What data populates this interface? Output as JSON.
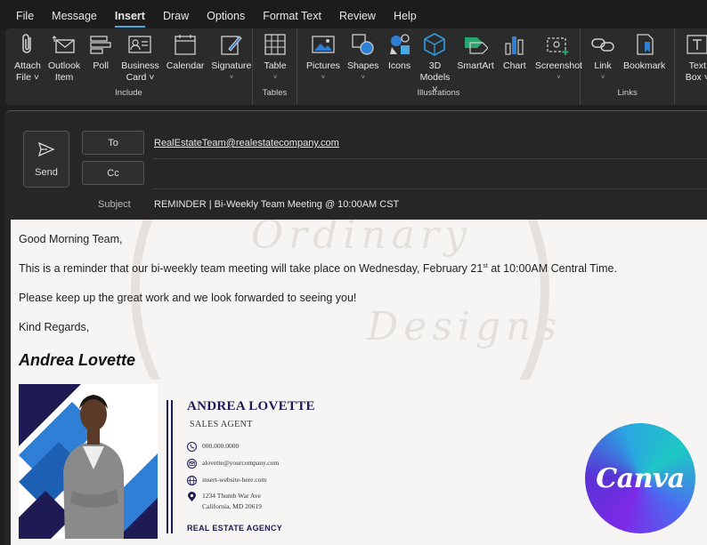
{
  "menu": [
    "File",
    "Message",
    "Insert",
    "Draw",
    "Options",
    "Format Text",
    "Review",
    "Help"
  ],
  "menu_active": "Insert",
  "ribbon": {
    "include": {
      "label": "Include",
      "buttons": [
        {
          "l1": "Attach",
          "l2": "File ˅"
        },
        {
          "l1": "Outlook",
          "l2": "Item"
        },
        {
          "l1": "Poll",
          "l2": ""
        },
        {
          "l1": "Business",
          "l2": "Card ˅"
        },
        {
          "l1": "Calendar",
          "l2": ""
        },
        {
          "l1": "Signature",
          "l2": "˅"
        }
      ]
    },
    "tables": {
      "label": "Tables",
      "buttons": [
        {
          "l1": "Table",
          "l2": "˅"
        }
      ]
    },
    "illustrations": {
      "label": "Illustrations",
      "buttons": [
        {
          "l1": "Pictures",
          "l2": "˅"
        },
        {
          "l1": "Shapes",
          "l2": "˅"
        },
        {
          "l1": "Icons",
          "l2": ""
        },
        {
          "l1": "3D",
          "l2": "Models ˅"
        },
        {
          "l1": "SmartArt",
          "l2": ""
        },
        {
          "l1": "Chart",
          "l2": ""
        },
        {
          "l1": "Screenshot",
          "l2": "˅"
        }
      ]
    },
    "links": {
      "label": "Links",
      "buttons": [
        {
          "l1": "Link",
          "l2": "˅"
        },
        {
          "l1": "Bookmark",
          "l2": ""
        }
      ]
    },
    "text": {
      "buttons": [
        {
          "l1": "Text",
          "l2": "Box ˅"
        }
      ]
    }
  },
  "compose": {
    "send_label": "Send",
    "to_label": "To",
    "cc_label": "Cc",
    "to_value": "RealEstateTeam@realestatecompany.com",
    "cc_value": "",
    "subject_label": "Subject",
    "subject_value": "REMINDER | Bi-Weekly Team Meeting @ 10:00AM CST"
  },
  "body": {
    "greeting": "Good Morning Team,",
    "line1_before": "This is a reminder that our bi-weekly team meeting will take place on Wednesday, February 21",
    "line1_sup": "st",
    "line1_after": " at 10:00AM Central Time.",
    "line2": "Please keep up the great work and we look forwarded to seeing you!",
    "closing": "Kind Regards,",
    "signature_name": "Andrea Lovette"
  },
  "card": {
    "name": "ANDREA LOVETTE",
    "title": "SALES AGENT",
    "phone": "000.000.0000",
    "email": "alovette@yourcompany.com",
    "website": "insert-website-here.com",
    "address1": "1234 Thumb War Ave",
    "address2": "California, MD 20619",
    "agency": "REAL ESTATE AGENCY"
  },
  "canva_logo": "Canva",
  "watermark_text": [
    "Ordinary",
    "Designs"
  ],
  "colors": {
    "accent": "#4aa8e0",
    "navy": "#1e1b54",
    "card_blue": "#2f7fd6"
  }
}
